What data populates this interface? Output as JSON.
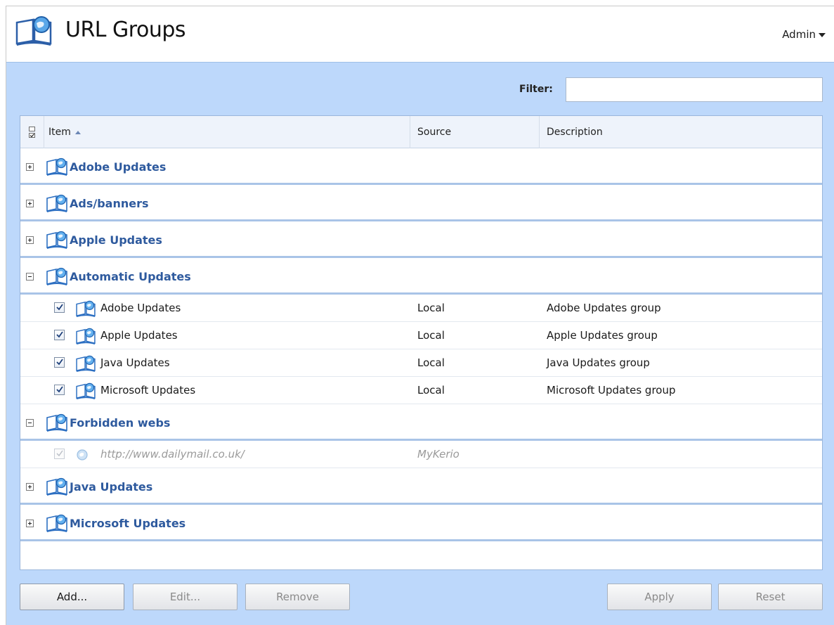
{
  "header": {
    "title": "URL Groups",
    "user_menu": "Admin",
    "logo_icon": "url-group-book-icon"
  },
  "filter": {
    "label": "Filter:",
    "value": ""
  },
  "grid": {
    "columns": {
      "item": "Item",
      "source": "Source",
      "description": "Description"
    },
    "groups": [
      {
        "label": "Adobe Updates",
        "expanded": false
      },
      {
        "label": "Ads/banners",
        "expanded": false
      },
      {
        "label": "Apple Updates",
        "expanded": false
      },
      {
        "label": "Automatic Updates",
        "expanded": true,
        "items": [
          {
            "label": "Adobe Updates",
            "source": "Local",
            "description": "Adobe Updates group",
            "checked": true
          },
          {
            "label": "Apple Updates",
            "source": "Local",
            "description": "Apple Updates group",
            "checked": true
          },
          {
            "label": "Java Updates",
            "source": "Local",
            "description": "Java Updates group",
            "checked": true
          },
          {
            "label": "Microsoft Updates",
            "source": "Local",
            "description": "Microsoft Updates group",
            "checked": true
          }
        ]
      },
      {
        "label": "Forbidden webs",
        "expanded": true,
        "items": [
          {
            "label": "http://www.dailymail.co.uk/",
            "source": "MyKerio",
            "description": "",
            "checked": true
          }
        ]
      },
      {
        "label": "Java Updates",
        "expanded": false
      },
      {
        "label": "Microsoft Updates",
        "expanded": false
      }
    ]
  },
  "buttons": {
    "add": "Add...",
    "edit": "Edit...",
    "remove": "Remove",
    "apply": "Apply",
    "reset": "Reset"
  },
  "colors": {
    "panel_background": "#bdd8fb",
    "group_label": "#2e5a9e",
    "group_divider": "#a9c4e7"
  }
}
